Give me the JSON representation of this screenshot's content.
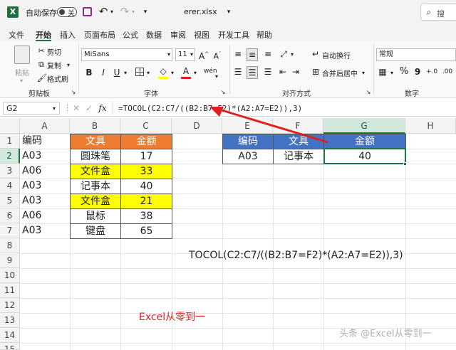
{
  "titlebar": {
    "autosave_label": "自动保存",
    "autosave_state": "关",
    "filename": "erer.xlsx",
    "search_placeholder": "搜"
  },
  "tabs": [
    "文件",
    "开始",
    "插入",
    "页面布局",
    "公式",
    "数据",
    "审阅",
    "视图",
    "开发工具",
    "帮助"
  ],
  "active_tab": "开始",
  "ribbon": {
    "clipboard": {
      "paste": "粘贴",
      "cut": "剪切",
      "copy": "复制",
      "format_painter": "格式刷",
      "group_label": "剪贴板"
    },
    "font": {
      "font_name": "MiSans",
      "font_size": "11",
      "bold": "B",
      "italic": "I",
      "underline": "U",
      "group_label": "字体"
    },
    "alignment": {
      "wrap_text": "自动换行",
      "merge_center": "合并后居中",
      "group_label": "对齐方式"
    },
    "number": {
      "format": "常规",
      "percent": "%",
      "comma": "9",
      "group_label": "数字"
    }
  },
  "formula_bar": {
    "name_box": "G2",
    "fx": "fx",
    "formula": "=TOCOL(C2:C7/((B2:B7=F2)*(A2:A7=E2)),3)"
  },
  "columns": [
    "A",
    "B",
    "C",
    "D",
    "E",
    "F",
    "G",
    "H"
  ],
  "rows": [
    "1",
    "2",
    "3",
    "4",
    "5",
    "6",
    "7",
    "8",
    "9",
    "10",
    "11",
    "12",
    "13",
    "14",
    "15"
  ],
  "table_left": {
    "header_a": "编码",
    "header_b": "文具",
    "header_c": "金额",
    "rows": [
      {
        "code": "A03",
        "item": "圆珠笔",
        "amount": "17"
      },
      {
        "code": "A06",
        "item": "文件盒",
        "amount": "33"
      },
      {
        "code": "A03",
        "item": "记事本",
        "amount": "40"
      },
      {
        "code": "A03",
        "item": "文件盒",
        "amount": "21"
      },
      {
        "code": "A06",
        "item": "鼠标",
        "amount": "38"
      },
      {
        "code": "A03",
        "item": "键盘",
        "amount": "65"
      }
    ]
  },
  "table_right": {
    "header_e": "编码",
    "header_f": "文具",
    "header_g": "金额",
    "val_e": "A03",
    "val_f": "记事本",
    "val_g": "40"
  },
  "annotation_formula": "TOCOL(C2:C7/((B2:B7=F2)*(A2:A7=E2)),3)",
  "annotation_brand": "Excel从零到一",
  "watermark": "头条 @Excel从零到一",
  "colors": {
    "excel_green": "#217346",
    "orange_header": "#ef7d31",
    "blue_header": "#4472c4",
    "highlight": "#ffff00",
    "arrow_red": "#e02020",
    "brand_red": "#e0201e"
  }
}
